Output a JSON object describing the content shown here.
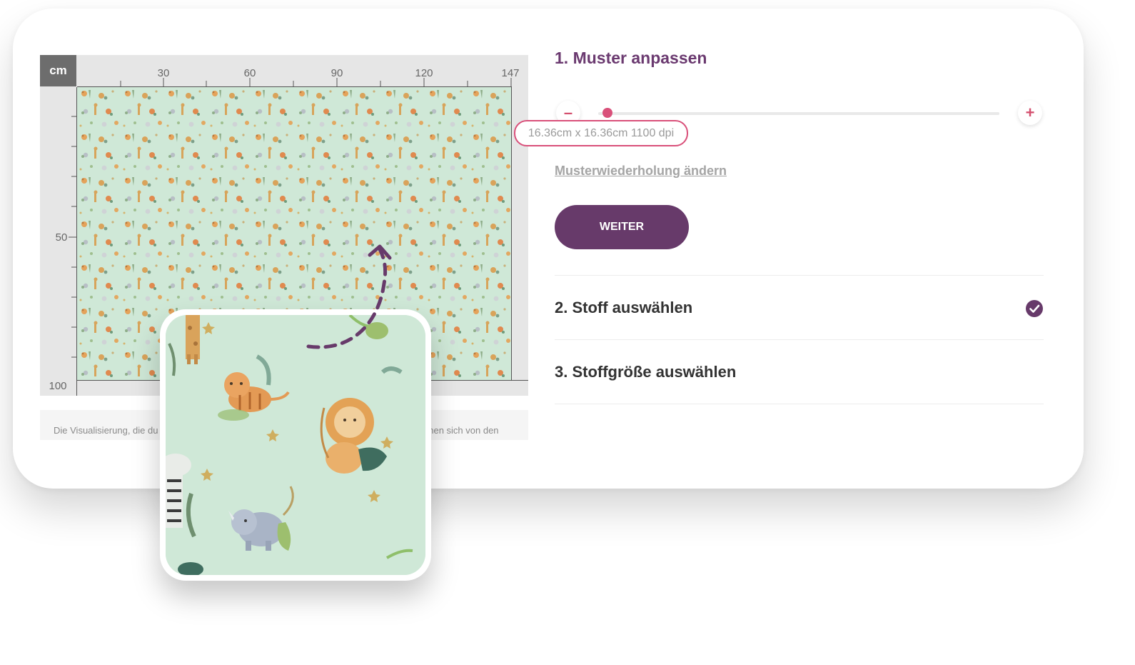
{
  "preview": {
    "unit_label": "cm",
    "top_ticks": [
      "30",
      "60",
      "90",
      "120",
      "147"
    ],
    "side_ticks": [
      "50",
      "100"
    ],
    "hint_text_left": "Die Visualisierung, die du",
    "hint_text_right": "nnen sich von den"
  },
  "panel": {
    "step1_title": "1. Muster anpassen",
    "zoom_minus": "–",
    "zoom_plus": "+",
    "slider_value_fraction": 0.01,
    "size_label": "16.36cm x 16.36cm 1100 dpi",
    "repeat_link": "Musterwiederholung ändern",
    "next_button": "WEITER",
    "step2_title": "2. Stoff auswählen",
    "step3_title": "3. Stoffgröße auswählen"
  },
  "icons": {
    "check": "check-circle-icon",
    "zoom_out": "minus-icon",
    "zoom_in": "plus-icon",
    "arrow": "curved-dashed-arrow-icon"
  },
  "colors": {
    "brand_purple": "#673a6a",
    "title_purple": "#6b3a70",
    "accent_pink": "#d9507a",
    "fabric_mint": "#cfe8d7"
  }
}
